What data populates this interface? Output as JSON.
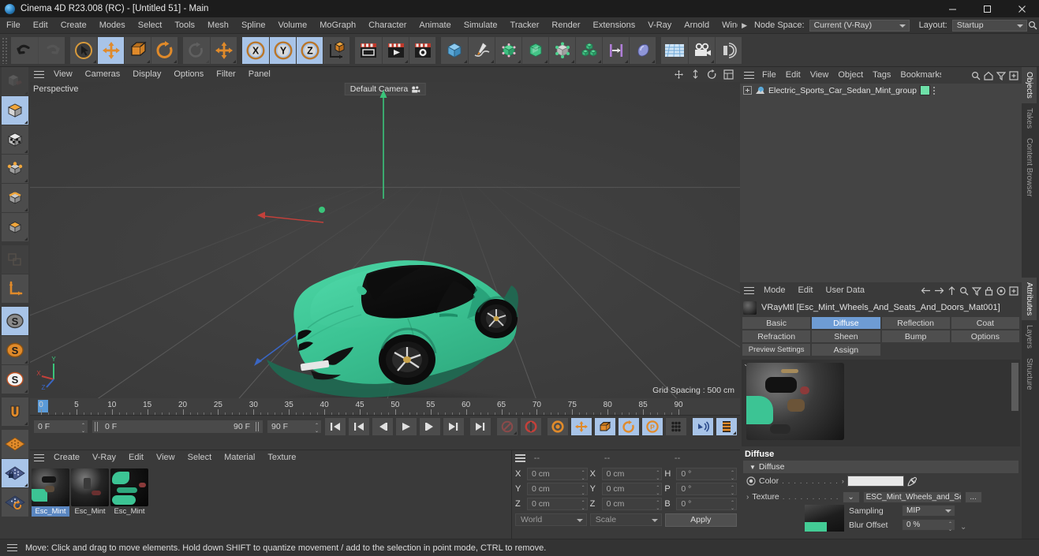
{
  "window": {
    "title": "Cinema 4D R23.008 (RC) - [Untitled 51] - Main",
    "minimize": "–",
    "maximize": "□",
    "close": "✕"
  },
  "menubar": {
    "items": [
      "File",
      "Edit",
      "Create",
      "Modes",
      "Select",
      "Tools",
      "Mesh",
      "Spline",
      "Volume",
      "MoGraph",
      "Character",
      "Animate",
      "Simulate",
      "Tracker",
      "Render",
      "Extensions",
      "V-Ray",
      "Arnold",
      "Windo"
    ],
    "overflow_arrow": "▶",
    "node_space_label": "Node Space:",
    "node_space_value": "Current (V-Ray)",
    "layout_label": "Layout:",
    "layout_value": "Startup",
    "search_icon": "search-icon"
  },
  "toolbar": {
    "groups": [
      {
        "name": "history",
        "buttons": [
          {
            "name": "undo-button",
            "icon": "undo-icon",
            "state": "normal"
          },
          {
            "name": "redo-button",
            "icon": "redo-icon",
            "state": "disabled"
          }
        ]
      },
      {
        "name": "transform",
        "buttons": [
          {
            "name": "live-selection-tool",
            "icon": "cursor-circle-icon",
            "state": "normal"
          },
          {
            "name": "move-tool",
            "icon": "move-arrows-icon",
            "state": "active"
          },
          {
            "name": "scale-tool",
            "icon": "scale-box-icon",
            "state": "normal"
          },
          {
            "name": "rotate-tool",
            "icon": "rotate-circle-icon",
            "state": "normal"
          }
        ]
      },
      {
        "name": "dynamic",
        "buttons": [
          {
            "name": "rotate-dynamic-tool",
            "icon": "rotate-faded-icon",
            "state": "disabled"
          },
          {
            "name": "move-dynamic-tool",
            "icon": "move-arrows-icon",
            "state": "normal"
          }
        ]
      },
      {
        "name": "axis-locks",
        "buttons": [
          {
            "name": "x-axis-toggle",
            "icon": "x-axis-icon",
            "state": "active"
          },
          {
            "name": "y-axis-toggle",
            "icon": "y-axis-icon",
            "state": "active"
          },
          {
            "name": "z-axis-toggle",
            "icon": "z-axis-icon",
            "state": "active"
          },
          {
            "name": "world-object-axis-toggle",
            "icon": "world-coord-icon",
            "state": "normal"
          }
        ]
      },
      {
        "name": "render",
        "buttons": [
          {
            "name": "render-view-button",
            "icon": "render-view-icon",
            "state": "normal"
          },
          {
            "name": "render-to-picture-viewer-button",
            "icon": "render-picture-icon",
            "state": "normal"
          },
          {
            "name": "render-settings-button",
            "icon": "render-settings-icon",
            "state": "normal"
          }
        ]
      },
      {
        "name": "create",
        "buttons": [
          {
            "name": "add-cube-button",
            "icon": "cube-icon",
            "state": "normal"
          },
          {
            "name": "add-spline-button",
            "icon": "pen-spline-icon",
            "state": "normal"
          },
          {
            "name": "add-generator-button",
            "icon": "generator-icon",
            "state": "normal"
          },
          {
            "name": "add-nurbs-button",
            "icon": "subdivision-icon",
            "state": "normal"
          },
          {
            "name": "add-deformer-button",
            "icon": "deformer-icon",
            "state": "normal"
          },
          {
            "name": "add-mograph-button",
            "icon": "mograph-cloner-icon",
            "state": "normal"
          },
          {
            "name": "add-scene-button",
            "icon": "scene-icon",
            "state": "normal"
          },
          {
            "name": "add-light-button",
            "icon": "light-icon",
            "state": "normal"
          }
        ]
      },
      {
        "name": "view",
        "buttons": [
          {
            "name": "add-floor-button",
            "icon": "floor-grid-icon",
            "state": "normal"
          },
          {
            "name": "add-camera-button",
            "icon": "camera-icon",
            "state": "normal"
          },
          {
            "name": "add-vray-light-button",
            "icon": "vray-light-icon",
            "state": "normal"
          }
        ]
      }
    ]
  },
  "left_tools": [
    {
      "name": "model-mode",
      "icon": "model-mode-icon",
      "state": "disabled"
    },
    {
      "name": "object-mode",
      "icon": "object-cube-icon",
      "state": "active"
    },
    {
      "name": "texture-mode",
      "icon": "texture-checker-icon",
      "state": "normal"
    },
    {
      "name": "point-mode",
      "icon": "point-mode-icon",
      "state": "normal"
    },
    {
      "name": "edge-mode",
      "icon": "edge-mode-icon",
      "state": "normal"
    },
    {
      "name": "polygon-mode",
      "icon": "polygon-mode-icon",
      "state": "normal"
    },
    {
      "name": "uv-mode",
      "icon": "uv-mode-icon",
      "state": "disabled"
    },
    {
      "name": "axis-mode",
      "icon": "axis-l-icon",
      "state": "normal"
    },
    {
      "name": "enable-axis-modification",
      "icon": "s-grey-icon",
      "state": "active"
    },
    {
      "name": "enable-snapping",
      "icon": "s-orange-icon",
      "state": "normal"
    },
    {
      "name": "workplane-lock",
      "icon": "s-white-icon",
      "state": "normal"
    },
    {
      "name": "magnet-tool",
      "icon": "magnet-icon",
      "state": "normal"
    },
    {
      "name": "workplane",
      "icon": "workplane-orange-icon",
      "state": "normal"
    },
    {
      "name": "lock-workplane",
      "icon": "workplane-lock-icon",
      "state": "active"
    },
    {
      "name": "planar-workplane",
      "icon": "workplane-rotate-icon",
      "state": "normal"
    }
  ],
  "viewport": {
    "menu": [
      "View",
      "Cameras",
      "Display",
      "Options",
      "Filter",
      "Panel"
    ],
    "label": "Perspective",
    "camera_label": "Default Camera",
    "grid_spacing": "Grid Spacing : 500 cm",
    "axis_gizmo": {
      "x": "X",
      "y": "Y",
      "z": "Z"
    },
    "car_body_color": "#3cc494",
    "car_glass_color": "#121212"
  },
  "timeline": {
    "ticks": [
      0,
      5,
      10,
      15,
      20,
      25,
      30,
      35,
      40,
      45,
      50,
      55,
      60,
      65,
      70,
      75,
      80,
      85,
      90
    ],
    "current_frame": "0 F",
    "range_start": "0 F",
    "range_end": "90 F",
    "document_end": "90 F",
    "end_frame_field": "0 F",
    "buttons": [
      {
        "name": "go-to-start-button",
        "icon": "skip-start-icon"
      },
      {
        "name": "go-to-previous-key-button",
        "icon": "prev-key-icon"
      },
      {
        "name": "go-to-previous-frame-button",
        "icon": "prev-frame-icon"
      },
      {
        "name": "play-button",
        "icon": "play-icon"
      },
      {
        "name": "go-to-next-frame-button",
        "icon": "next-frame-icon"
      },
      {
        "name": "go-to-next-key-button",
        "icon": "next-key-icon"
      },
      {
        "name": "go-to-end-button",
        "icon": "skip-end-icon"
      },
      {
        "name": "record-active-objects-button",
        "icon": "record-disabled-icon"
      },
      {
        "name": "autokeying-button",
        "icon": "autokey-icon"
      },
      {
        "name": "keyframe-selection-button",
        "icon": "keyframe-gear-icon"
      },
      {
        "name": "position-key-toggle",
        "icon": "move-key-icon"
      },
      {
        "name": "scale-key-toggle",
        "icon": "scale-key-icon"
      },
      {
        "name": "rotation-key-toggle",
        "icon": "rotate-key-icon"
      },
      {
        "name": "param-key-toggle",
        "icon": "param-key-icon"
      },
      {
        "name": "point-level-animation-button",
        "icon": "pla-dots-icon"
      },
      {
        "name": "sound-button",
        "icon": "sound-icon"
      },
      {
        "name": "film-strip-button",
        "icon": "film-strip-icon"
      }
    ]
  },
  "material_manager": {
    "menu": [
      "Create",
      "V-Ray",
      "Edit",
      "View",
      "Select",
      "Material",
      "Texture"
    ],
    "materials": [
      {
        "name": "Esc_Mint",
        "selected": true
      },
      {
        "name": "Esc_Mint",
        "selected": false
      },
      {
        "name": "Esc_Mint",
        "selected": false
      }
    ]
  },
  "coordinates": {
    "headers": [
      "--",
      "--",
      "--"
    ],
    "rows": [
      {
        "pos_label": "X",
        "pos_value": "0 cm",
        "size_label": "X",
        "size_value": "0 cm",
        "rot_label": "H",
        "rot_value": "0 °"
      },
      {
        "pos_label": "Y",
        "pos_value": "0 cm",
        "size_label": "Y",
        "size_value": "0 cm",
        "rot_label": "P",
        "rot_value": "0 °"
      },
      {
        "pos_label": "Z",
        "pos_value": "0 cm",
        "size_label": "Z",
        "size_value": "0 cm",
        "rot_label": "B",
        "rot_value": "0 °"
      }
    ],
    "system": "World",
    "mode": "Scale",
    "apply_label": "Apply"
  },
  "object_manager": {
    "menu": [
      "File",
      "Edit",
      "View",
      "Object",
      "Tags",
      "Bookmarks"
    ],
    "icons": [
      "search-icon",
      "home-icon",
      "filter-icon",
      "add-icon"
    ],
    "objects": [
      {
        "name": "Electric_Sports_Car_Sedan_Mint_group",
        "swatch": "#6ee0a8"
      }
    ]
  },
  "attributes": {
    "menu": [
      "Mode",
      "Edit",
      "User Data"
    ],
    "icons": [
      "back-arrow-icon",
      "forward-arrow-icon",
      "up-arrow-icon",
      "search-icon",
      "filter-icon",
      "lock-icon",
      "target-icon",
      "add-icon"
    ],
    "material_title": "VRayMtl [Esc_Mint_Wheels_And_Seats_And_Doors_Mat001]",
    "tabs": [
      {
        "label": "Basic",
        "active": false
      },
      {
        "label": "Diffuse",
        "active": true
      },
      {
        "label": "Reflection",
        "active": false
      },
      {
        "label": "Coat",
        "active": false
      },
      {
        "label": "Refraction",
        "active": false
      },
      {
        "label": "Sheen",
        "active": false
      },
      {
        "label": "Bump",
        "active": false
      },
      {
        "label": "Options",
        "active": false
      },
      {
        "label": "Preview Settings",
        "active": false
      },
      {
        "label": "Assign",
        "active": false
      }
    ],
    "section_title": "Diffuse",
    "group_label": "Diffuse",
    "color_label": "Color",
    "color_dots": ". . . . . . . . . .",
    "color_value": "#e8e8e8",
    "eyedropper_icon": "eyedropper-icon",
    "texture_label": "Texture",
    "texture_dots": ". . . . . . . . . .",
    "texture_value": "ESC_Mint_Wheels_and_Seat",
    "texture_browse": "...",
    "sampling_label": "Sampling",
    "sampling_value": "MIP",
    "blur_offset_label": "Blur Offset",
    "blur_offset_value": "0 %"
  },
  "vertical_tabs_top": [
    {
      "label": "Objects",
      "active": true
    },
    {
      "label": "Takes",
      "active": false
    },
    {
      "label": "Content Browser",
      "active": false
    }
  ],
  "vertical_tabs_bottom": [
    {
      "label": "Attributes",
      "active": true
    },
    {
      "label": "Layers",
      "active": false
    },
    {
      "label": "Structure",
      "active": false
    }
  ],
  "statusbar": {
    "text": "Move: Click and drag to move elements. Hold down SHIFT to quantize movement / add to the selection in point mode, CTRL to remove."
  }
}
